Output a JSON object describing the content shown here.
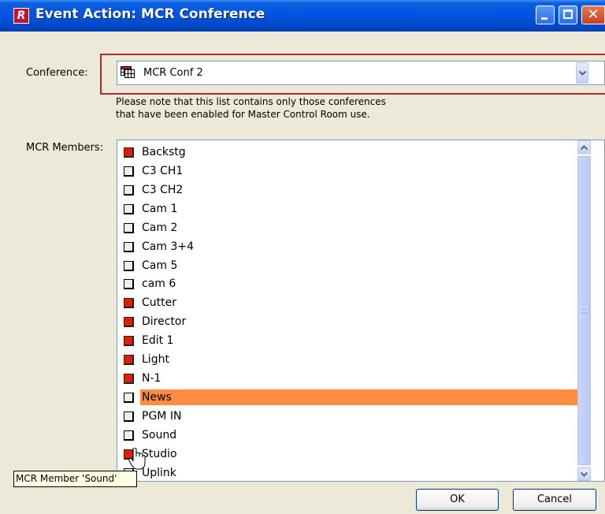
{
  "window": {
    "title": "Event Action: MCR Conference",
    "logo_letter": "R",
    "close_glyph": "✕"
  },
  "conference": {
    "label": "Conference:",
    "selected": "MCR Conf 2",
    "icon": "conference-grid-icon",
    "note_line1": "Please note that this list contains only those conferences",
    "note_line2": "that have been enabled for Master Control Room use."
  },
  "members": {
    "label": "MCR Members:",
    "items": [
      {
        "label": "Backstg",
        "checked": true
      },
      {
        "label": "C3  CH1",
        "checked": false
      },
      {
        "label": "C3  CH2",
        "checked": false
      },
      {
        "label": "Cam 1",
        "checked": false
      },
      {
        "label": "Cam 2",
        "checked": false
      },
      {
        "label": "Cam 3+4",
        "checked": false
      },
      {
        "label": "Cam 5",
        "checked": false
      },
      {
        "label": "cam 6",
        "checked": false
      },
      {
        "label": "Cutter",
        "checked": true
      },
      {
        "label": "Director",
        "checked": true
      },
      {
        "label": "Edit 1",
        "checked": true
      },
      {
        "label": "Light",
        "checked": true
      },
      {
        "label": "N-1",
        "checked": true
      },
      {
        "label": "News",
        "checked": false,
        "selected": true
      },
      {
        "label": "PGM IN",
        "checked": false
      },
      {
        "label": "Sound",
        "checked": false
      },
      {
        "label": "Studio",
        "checked": true
      },
      {
        "label": "Uplink",
        "checked": false
      }
    ],
    "checked_color": "#e21d06",
    "selected_color": "#ff8c40"
  },
  "tooltip": {
    "text": "MCR Member 'Sound'"
  },
  "buttons": {
    "ok": "OK",
    "cancel": "Cancel"
  },
  "colors": {
    "titlebar": "#0054e3",
    "dialog_bg": "#ece9d8",
    "highlight_border": "#b3292e"
  }
}
